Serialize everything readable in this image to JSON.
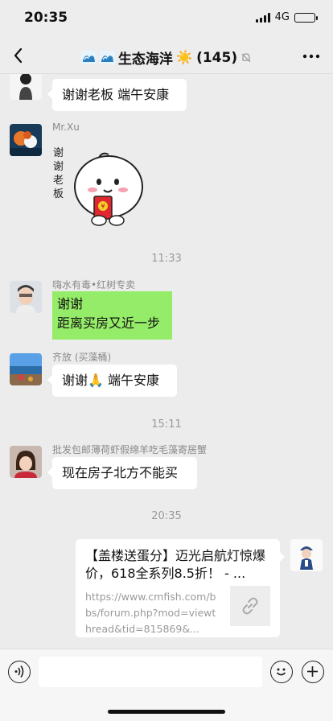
{
  "status_bar": {
    "time": "20:35",
    "network": "4G",
    "battery_level": 0.35
  },
  "header": {
    "title": "生态海洋",
    "sun": "☀️",
    "count": "(145)"
  },
  "messages": [
    {
      "id": "m1",
      "text": "谢谢老板 端午安康"
    },
    {
      "id": "m2",
      "sender": "Mr.Xu",
      "sticker_text": "谢谢老板",
      "sticker_coin": "¥"
    },
    {
      "id": "ts1",
      "time": "11:33"
    },
    {
      "id": "m3",
      "sender": "嗨水有毒•红树专卖",
      "text_line1": "谢谢",
      "text_line2": "距离买房又近一步"
    },
    {
      "id": "m4",
      "sender": "齐放 (买藻桶)",
      "text_before": "谢谢",
      "emoji": "🙏",
      "text_after": "端午安康"
    },
    {
      "id": "ts2",
      "time": "15:11"
    },
    {
      "id": "m5",
      "sender": "批发包邮薄荷虾假绵羊吃毛藻寄居蟹",
      "text": "现在房子北方不能买"
    },
    {
      "id": "ts3",
      "time": "20:35"
    },
    {
      "id": "m6",
      "title": "【盖楼送蛋分】迈光启航灯惊爆价，618全系列8.5折！ - ...",
      "url": "https://www.cmfish.com/bbs/forum.php?mod=viewthread&tid=815869&..."
    }
  ],
  "colors": {
    "background": "#ececec",
    "bubble_self": "#95ec69",
    "bubble_other": "#ffffff"
  },
  "icons": [
    "back-icon",
    "mute-icon",
    "more-icon",
    "voice-icon",
    "emoji-icon",
    "plus-icon",
    "link-icon"
  ]
}
